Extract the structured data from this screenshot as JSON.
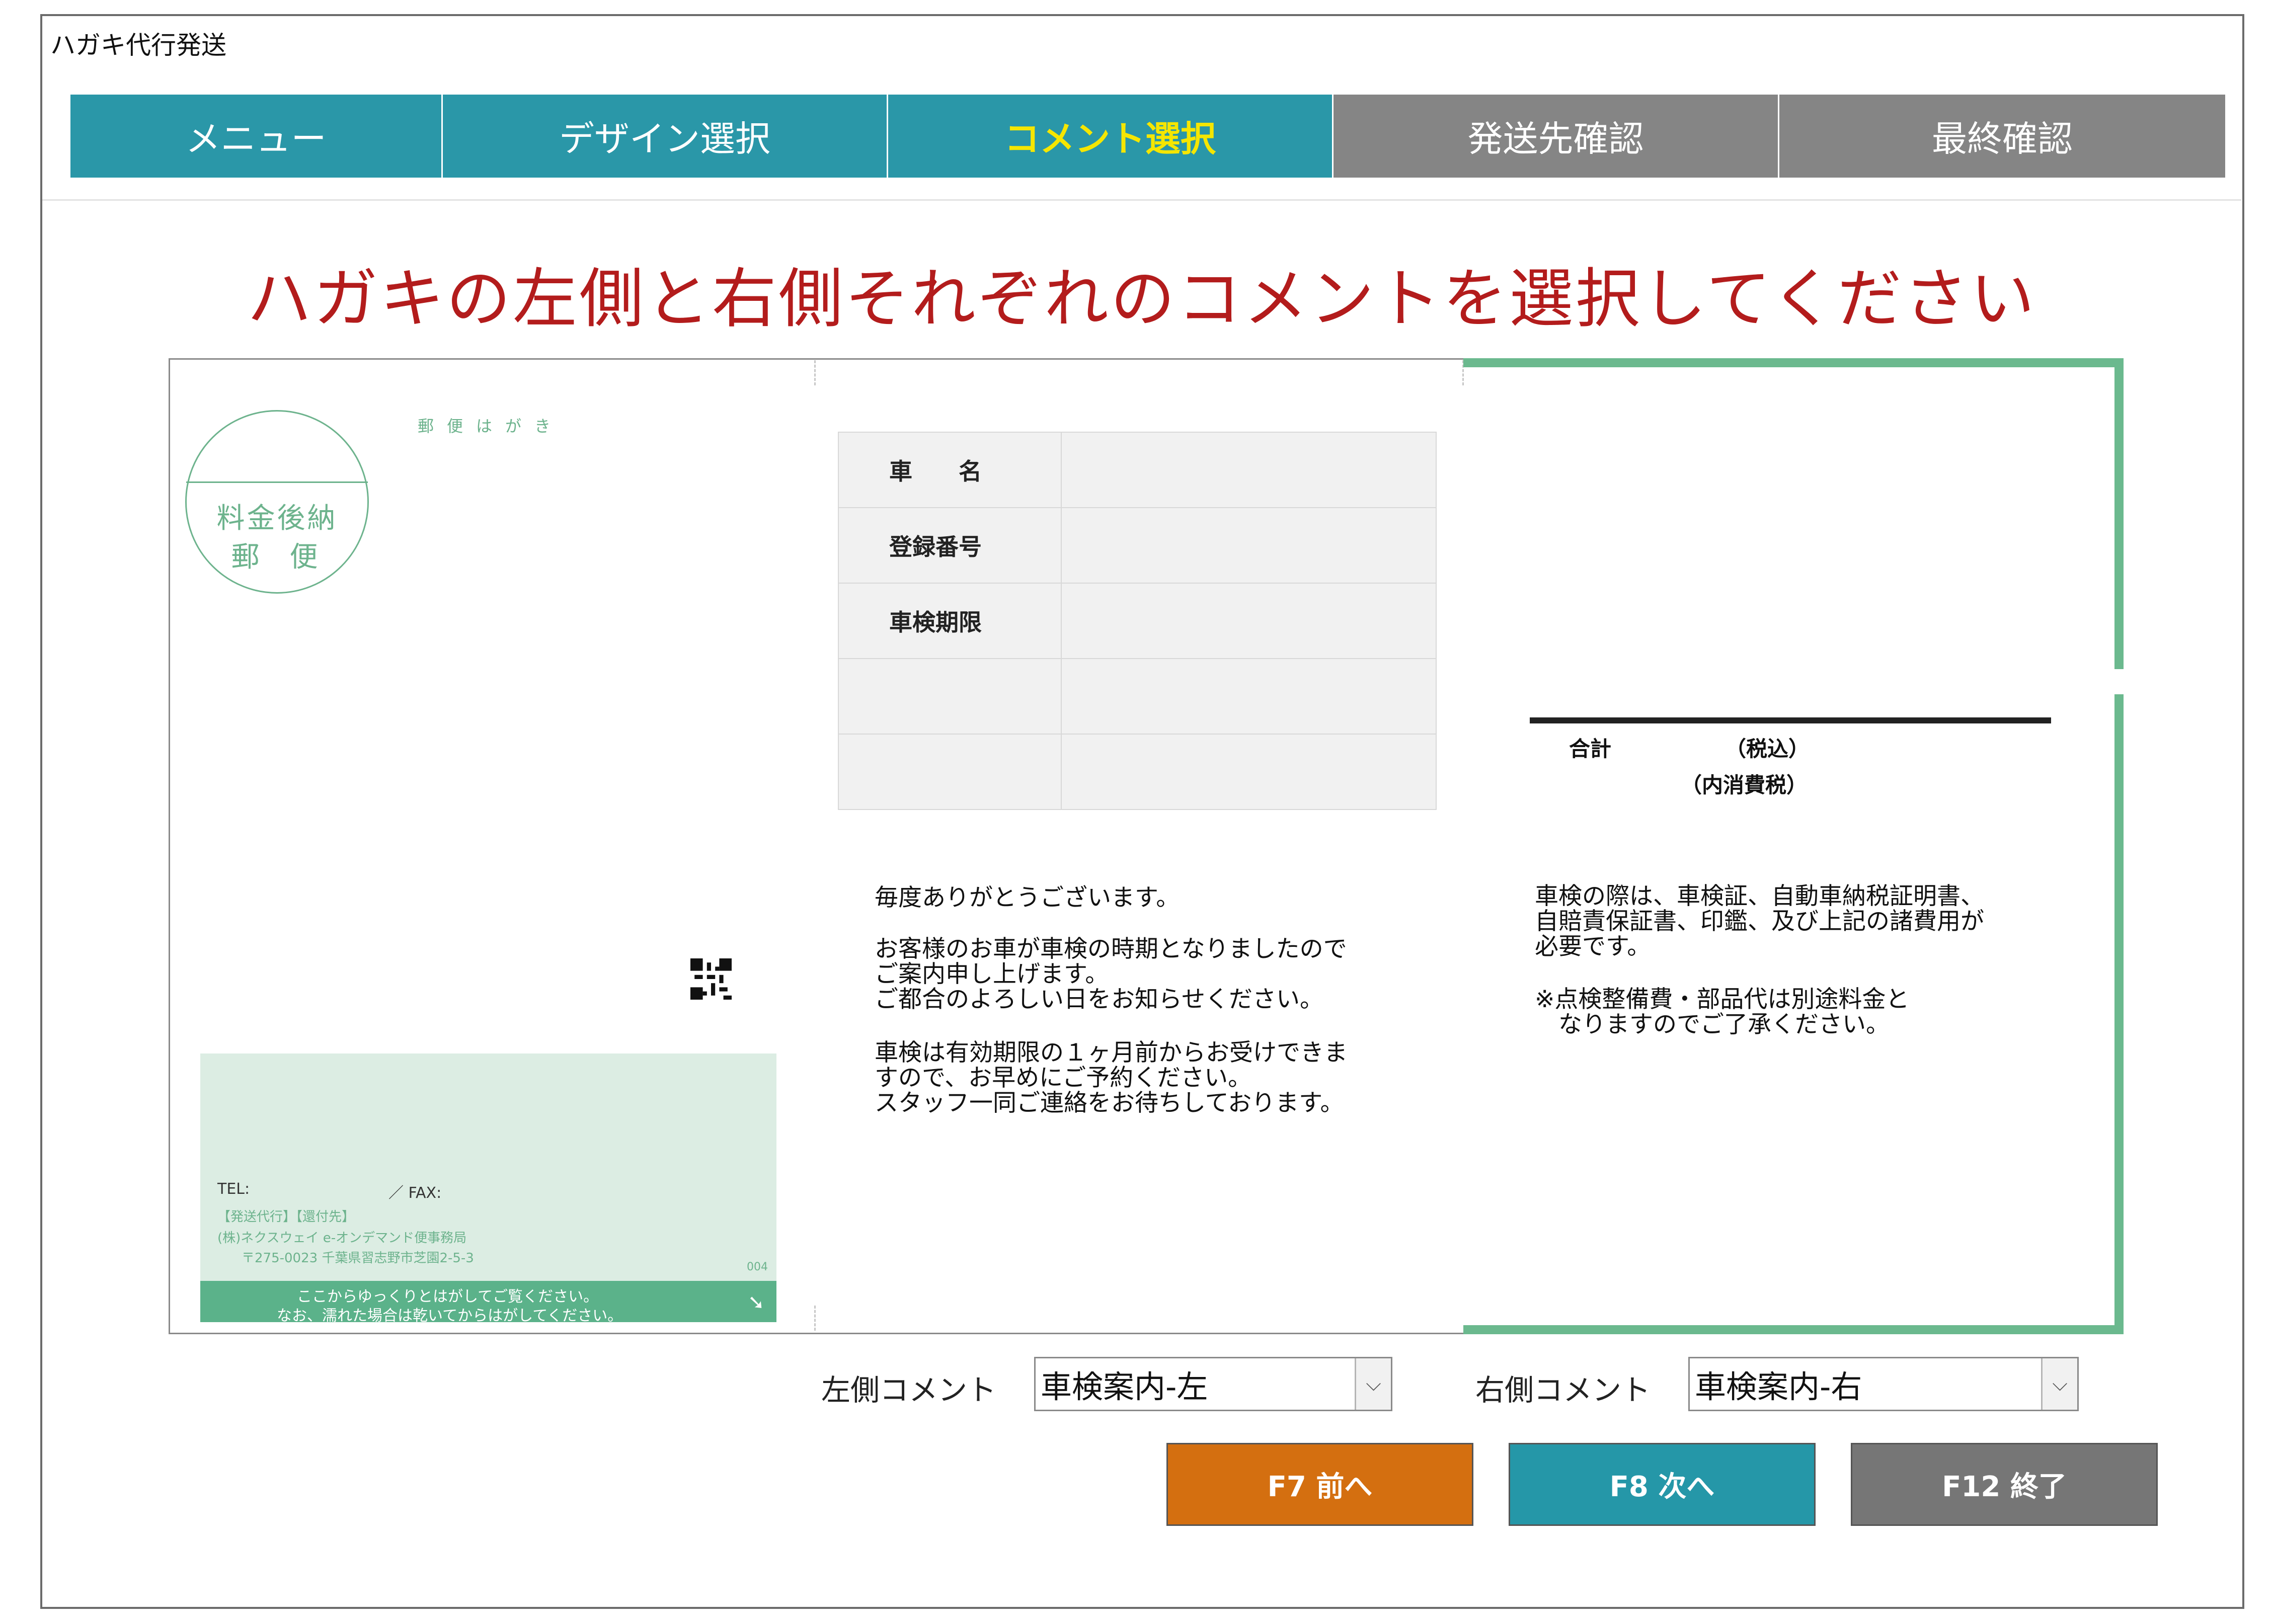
{
  "window": {
    "title": "ハガキ代行発送"
  },
  "tabs": [
    {
      "label": "メニュー",
      "state": "teal"
    },
    {
      "label": "デザイン選択",
      "state": "teal"
    },
    {
      "label": "コメント選択",
      "state": "active"
    },
    {
      "label": "発送先確認",
      "state": "gray"
    },
    {
      "label": "最終確認",
      "state": "gray"
    }
  ],
  "instruction": "ハガキの左側と右側それぞれのコメントを選択してください",
  "postcard": {
    "stamp": {
      "line1": "料金後納",
      "line2": "郵便"
    },
    "label": "郵便はがき",
    "sender": {
      "tel": "TEL:",
      "fax": "／ FAX:",
      "line1": "【発送代行】【還付先】",
      "line2": "(株)ネクスウェイ e-オンデマンド便事務局",
      "line3": "〒275-0023 千葉県習志野市芝園2-5-3",
      "code": "004",
      "peel1": "ここからゆっくりとはがしてご覧ください。",
      "peel2": "なお、濡れた場合は乾いてからはがしてください。"
    },
    "table": {
      "rows": [
        {
          "label": "車　　名"
        },
        {
          "label": "登録番号"
        },
        {
          "label": "車検期限"
        },
        {
          "label": ""
        },
        {
          "label": ""
        }
      ]
    },
    "left_message": [
      "毎度ありがとうございます。",
      "お客様のお車が車検の時期となりましたので",
      "ご案内申し上げます。",
      "ご都合のよろしい日をお知らせください。",
      "車検は有効期限の１ヶ月前からお受けできま",
      "すので、お早めにご予約ください。",
      "スタッフ一同ご連絡をお待ちしております。"
    ],
    "total": {
      "label": "合計",
      "tax_in": "（税込）",
      "tax_inner": "（内消費税）"
    },
    "right_message": [
      "車検の際は、車検証、自動車納税証明書、",
      "自賠責保証書、印鑑、及び上記の諸費用が",
      "必要です。",
      "※点検整備費・部品代は別途料金と",
      "　なりますのでご了承ください。"
    ]
  },
  "selectors": {
    "left": {
      "label": "左側コメント",
      "value": "車検案内-左"
    },
    "right": {
      "label": "右側コメント",
      "value": "車検案内-右"
    }
  },
  "buttons": {
    "prev": "F7 前へ",
    "next": "F8 次へ",
    "exit": "F12 終了"
  },
  "colors": {
    "tab_teal": "#2a97a8",
    "tab_gray": "#858585",
    "tab_active_text": "#f5e600",
    "instruction": "#b31c1c",
    "postcard_green": "#6bb98e",
    "btn_prev": "#d46f10",
    "btn_next": "#2597a8",
    "btn_exit": "#767676"
  }
}
